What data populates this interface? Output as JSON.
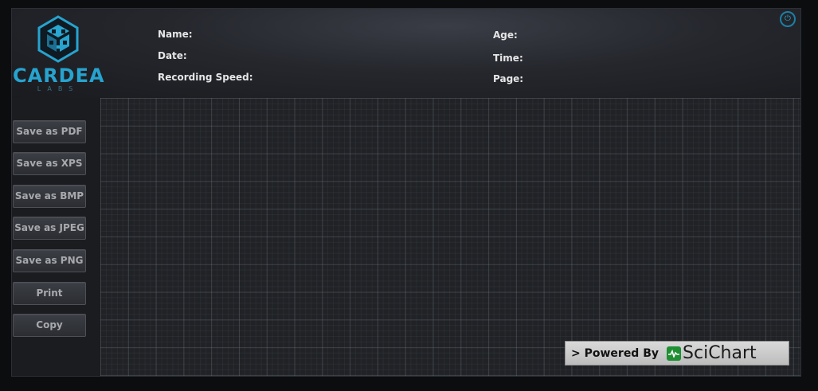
{
  "logo": {
    "name": "CARDEA",
    "sub": "LABS"
  },
  "header": {
    "name_label": "Name:",
    "date_label": "Date:",
    "recording_speed_label": "Recording Speed:",
    "age_label": "Age:",
    "time_label": "Time:",
    "page_label": "Page:"
  },
  "sidebar": {
    "buttons": [
      {
        "label": "Save as PDF"
      },
      {
        "label": "Save as XPS"
      },
      {
        "label": "Save as BMP"
      },
      {
        "label": "Save as JPEG"
      },
      {
        "label": "Save as PNG"
      },
      {
        "label": "Print"
      },
      {
        "label": "Copy"
      }
    ]
  },
  "power_button": {
    "icon": "power-icon",
    "glyph": "⏻"
  },
  "badge": {
    "powered_by": "> Powered By",
    "brand": "SciChart"
  },
  "colors": {
    "accent": "#27a3cf",
    "background": "#1d1f24",
    "grid_major": "#5a5f6b",
    "badge_green": "#1f8f33"
  }
}
